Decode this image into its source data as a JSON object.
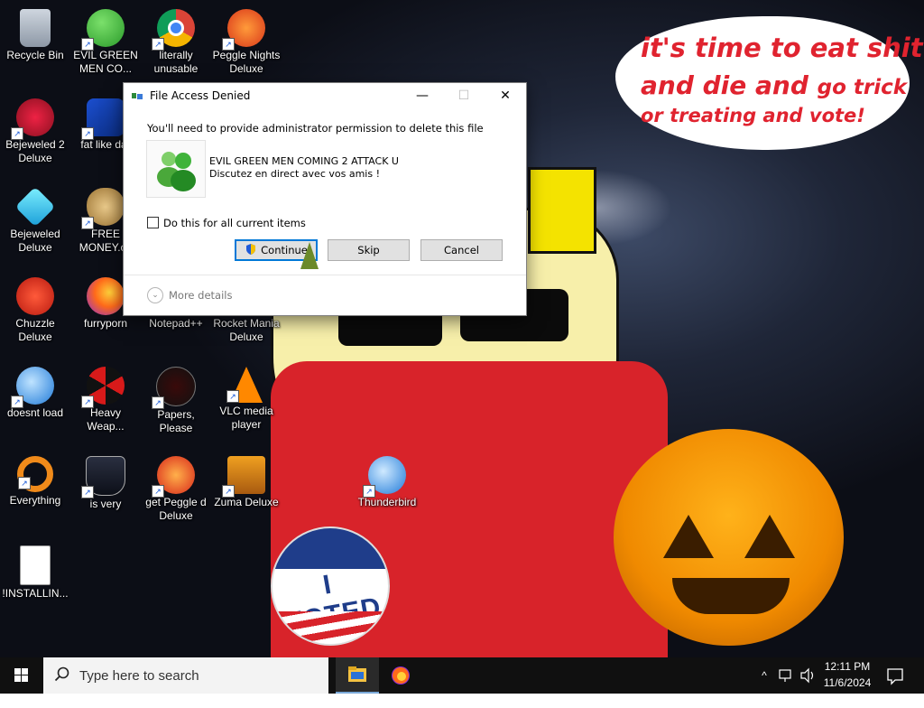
{
  "desktop": {
    "speech_bubble": {
      "line1": "it's time to eat shit",
      "line2a": "and die and",
      "line2b": "go trick",
      "line3": "or treating and vote!"
    },
    "badge_text": "I VOTED",
    "icons": [
      {
        "label": "Recycle Bin"
      },
      {
        "label": "EVIL GREEN MEN CO..."
      },
      {
        "label": "literally unusable"
      },
      {
        "label": "Peggle Nights Deluxe"
      },
      {
        "label": "Bejeweled 2 Deluxe"
      },
      {
        "label": "fat like dar"
      },
      {
        "label": "Bejeweled Deluxe"
      },
      {
        "label": "FREE MONEY.co"
      },
      {
        "label": "Chuzzle Deluxe"
      },
      {
        "label": "furryporn"
      },
      {
        "label": "Notepad++"
      },
      {
        "label": "Rocket Mania Deluxe"
      },
      {
        "label": "doesnt load"
      },
      {
        "label": "Heavy Weap..."
      },
      {
        "label": "Papers, Please"
      },
      {
        "label": "VLC media player"
      },
      {
        "label": "Everything"
      },
      {
        "label": "is very"
      },
      {
        "label": "get Peggle d Deluxe"
      },
      {
        "label": "Zuma Deluxe"
      },
      {
        "label": "Thunderbird"
      },
      {
        "label": "!INSTALLIN..."
      }
    ]
  },
  "dialog": {
    "title": "File Access Denied",
    "message": "You'll need to provide administrator permission to delete this file",
    "file_name": "EVIL GREEN MEN COMING 2 ATTACK U",
    "file_desc": "Discutez en direct avec vos amis !",
    "checkbox_label": "Do this for all current items",
    "continue_label": "Continue",
    "skip_label": "Skip",
    "cancel_label": "Cancel",
    "more_details": "More details",
    "minimize": "—",
    "maximize": "☐",
    "close": "✕"
  },
  "taskbar": {
    "search_placeholder": "Type here to search",
    "time": "12:11 PM",
    "date": "11/6/2024"
  }
}
